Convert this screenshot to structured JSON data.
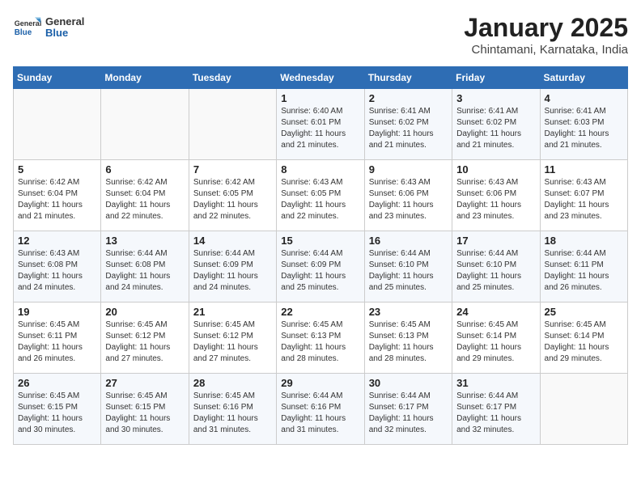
{
  "header": {
    "logo_general": "General",
    "logo_blue": "Blue",
    "month_title": "January 2025",
    "location": "Chintamani, Karnataka, India"
  },
  "days_of_week": [
    "Sunday",
    "Monday",
    "Tuesday",
    "Wednesday",
    "Thursday",
    "Friday",
    "Saturday"
  ],
  "weeks": [
    [
      {
        "day": "",
        "sunrise": "",
        "sunset": "",
        "daylight": ""
      },
      {
        "day": "",
        "sunrise": "",
        "sunset": "",
        "daylight": ""
      },
      {
        "day": "",
        "sunrise": "",
        "sunset": "",
        "daylight": ""
      },
      {
        "day": "1",
        "sunrise": "Sunrise: 6:40 AM",
        "sunset": "Sunset: 6:01 PM",
        "daylight": "Daylight: 11 hours and 21 minutes."
      },
      {
        "day": "2",
        "sunrise": "Sunrise: 6:41 AM",
        "sunset": "Sunset: 6:02 PM",
        "daylight": "Daylight: 11 hours and 21 minutes."
      },
      {
        "day": "3",
        "sunrise": "Sunrise: 6:41 AM",
        "sunset": "Sunset: 6:02 PM",
        "daylight": "Daylight: 11 hours and 21 minutes."
      },
      {
        "day": "4",
        "sunrise": "Sunrise: 6:41 AM",
        "sunset": "Sunset: 6:03 PM",
        "daylight": "Daylight: 11 hours and 21 minutes."
      }
    ],
    [
      {
        "day": "5",
        "sunrise": "Sunrise: 6:42 AM",
        "sunset": "Sunset: 6:04 PM",
        "daylight": "Daylight: 11 hours and 21 minutes."
      },
      {
        "day": "6",
        "sunrise": "Sunrise: 6:42 AM",
        "sunset": "Sunset: 6:04 PM",
        "daylight": "Daylight: 11 hours and 22 minutes."
      },
      {
        "day": "7",
        "sunrise": "Sunrise: 6:42 AM",
        "sunset": "Sunset: 6:05 PM",
        "daylight": "Daylight: 11 hours and 22 minutes."
      },
      {
        "day": "8",
        "sunrise": "Sunrise: 6:43 AM",
        "sunset": "Sunset: 6:05 PM",
        "daylight": "Daylight: 11 hours and 22 minutes."
      },
      {
        "day": "9",
        "sunrise": "Sunrise: 6:43 AM",
        "sunset": "Sunset: 6:06 PM",
        "daylight": "Daylight: 11 hours and 23 minutes."
      },
      {
        "day": "10",
        "sunrise": "Sunrise: 6:43 AM",
        "sunset": "Sunset: 6:06 PM",
        "daylight": "Daylight: 11 hours and 23 minutes."
      },
      {
        "day": "11",
        "sunrise": "Sunrise: 6:43 AM",
        "sunset": "Sunset: 6:07 PM",
        "daylight": "Daylight: 11 hours and 23 minutes."
      }
    ],
    [
      {
        "day": "12",
        "sunrise": "Sunrise: 6:43 AM",
        "sunset": "Sunset: 6:08 PM",
        "daylight": "Daylight: 11 hours and 24 minutes."
      },
      {
        "day": "13",
        "sunrise": "Sunrise: 6:44 AM",
        "sunset": "Sunset: 6:08 PM",
        "daylight": "Daylight: 11 hours and 24 minutes."
      },
      {
        "day": "14",
        "sunrise": "Sunrise: 6:44 AM",
        "sunset": "Sunset: 6:09 PM",
        "daylight": "Daylight: 11 hours and 24 minutes."
      },
      {
        "day": "15",
        "sunrise": "Sunrise: 6:44 AM",
        "sunset": "Sunset: 6:09 PM",
        "daylight": "Daylight: 11 hours and 25 minutes."
      },
      {
        "day": "16",
        "sunrise": "Sunrise: 6:44 AM",
        "sunset": "Sunset: 6:10 PM",
        "daylight": "Daylight: 11 hours and 25 minutes."
      },
      {
        "day": "17",
        "sunrise": "Sunrise: 6:44 AM",
        "sunset": "Sunset: 6:10 PM",
        "daylight": "Daylight: 11 hours and 25 minutes."
      },
      {
        "day": "18",
        "sunrise": "Sunrise: 6:44 AM",
        "sunset": "Sunset: 6:11 PM",
        "daylight": "Daylight: 11 hours and 26 minutes."
      }
    ],
    [
      {
        "day": "19",
        "sunrise": "Sunrise: 6:45 AM",
        "sunset": "Sunset: 6:11 PM",
        "daylight": "Daylight: 11 hours and 26 minutes."
      },
      {
        "day": "20",
        "sunrise": "Sunrise: 6:45 AM",
        "sunset": "Sunset: 6:12 PM",
        "daylight": "Daylight: 11 hours and 27 minutes."
      },
      {
        "day": "21",
        "sunrise": "Sunrise: 6:45 AM",
        "sunset": "Sunset: 6:12 PM",
        "daylight": "Daylight: 11 hours and 27 minutes."
      },
      {
        "day": "22",
        "sunrise": "Sunrise: 6:45 AM",
        "sunset": "Sunset: 6:13 PM",
        "daylight": "Daylight: 11 hours and 28 minutes."
      },
      {
        "day": "23",
        "sunrise": "Sunrise: 6:45 AM",
        "sunset": "Sunset: 6:13 PM",
        "daylight": "Daylight: 11 hours and 28 minutes."
      },
      {
        "day": "24",
        "sunrise": "Sunrise: 6:45 AM",
        "sunset": "Sunset: 6:14 PM",
        "daylight": "Daylight: 11 hours and 29 minutes."
      },
      {
        "day": "25",
        "sunrise": "Sunrise: 6:45 AM",
        "sunset": "Sunset: 6:14 PM",
        "daylight": "Daylight: 11 hours and 29 minutes."
      }
    ],
    [
      {
        "day": "26",
        "sunrise": "Sunrise: 6:45 AM",
        "sunset": "Sunset: 6:15 PM",
        "daylight": "Daylight: 11 hours and 30 minutes."
      },
      {
        "day": "27",
        "sunrise": "Sunrise: 6:45 AM",
        "sunset": "Sunset: 6:15 PM",
        "daylight": "Daylight: 11 hours and 30 minutes."
      },
      {
        "day": "28",
        "sunrise": "Sunrise: 6:45 AM",
        "sunset": "Sunset: 6:16 PM",
        "daylight": "Daylight: 11 hours and 31 minutes."
      },
      {
        "day": "29",
        "sunrise": "Sunrise: 6:44 AM",
        "sunset": "Sunset: 6:16 PM",
        "daylight": "Daylight: 11 hours and 31 minutes."
      },
      {
        "day": "30",
        "sunrise": "Sunrise: 6:44 AM",
        "sunset": "Sunset: 6:17 PM",
        "daylight": "Daylight: 11 hours and 32 minutes."
      },
      {
        "day": "31",
        "sunrise": "Sunrise: 6:44 AM",
        "sunset": "Sunset: 6:17 PM",
        "daylight": "Daylight: 11 hours and 32 minutes."
      },
      {
        "day": "",
        "sunrise": "",
        "sunset": "",
        "daylight": ""
      }
    ]
  ]
}
